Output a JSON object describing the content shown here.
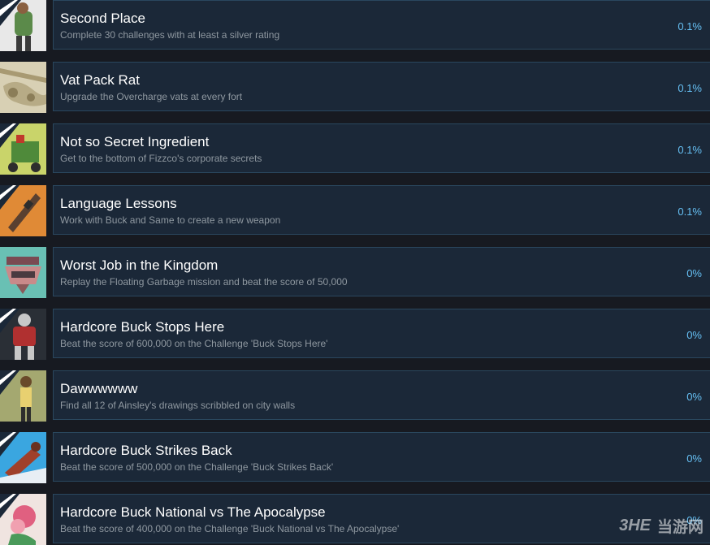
{
  "achievements": [
    {
      "title": "Second Place",
      "desc": "Complete 30 challenges with at least a silver rating",
      "percent": "0.1%",
      "icon": "character-icon",
      "color": "#6a8a4a"
    },
    {
      "title": "Vat Pack Rat",
      "desc": "Upgrade the Overcharge vats at every fort",
      "percent": "0.1%",
      "icon": "vat-icon",
      "color": "#cfc6a6"
    },
    {
      "title": "Not so Secret Ingredient",
      "desc": "Get to the bottom of Fizzco's corporate secrets",
      "percent": "0.1%",
      "icon": "machine-icon",
      "color": "#7aa04a"
    },
    {
      "title": "Language Lessons",
      "desc": "Work with Buck and Same to create a new weapon",
      "percent": "0.1%",
      "icon": "weapon-icon",
      "color": "#d07a2e"
    },
    {
      "title": "Worst Job in the Kingdom",
      "desc": "Replay the Floating Garbage mission and beat the score of 50,000",
      "percent": "0%",
      "icon": "garbage-icon",
      "color": "#5fb3a8"
    },
    {
      "title": "Hardcore Buck Stops Here",
      "desc": "Beat the score of 600,000 on the Challenge 'Buck Stops Here'",
      "percent": "0%",
      "icon": "robot-icon",
      "color": "#3a4048"
    },
    {
      "title": "Dawwwwww",
      "desc": "Find all 12 of Ainsley's drawings scribbled on city walls",
      "percent": "0%",
      "icon": "girl-icon",
      "color": "#9ea26a"
    },
    {
      "title": "Hardcore Buck Strikes Back",
      "desc": "Beat the score of 500,000 on the Challenge 'Buck Strikes Back'",
      "percent": "0%",
      "icon": "fighter-icon",
      "color": "#3aa0d8"
    },
    {
      "title": "Hardcore Buck National vs The Apocalypse",
      "desc": "Beat the score of 400,000 on the Challenge 'Buck National vs The Apocalypse'",
      "percent": "0%",
      "icon": "flower-icon",
      "color": "#e89aa8"
    }
  ],
  "watermark": {
    "logo": "3HE",
    "text": "当游网"
  }
}
